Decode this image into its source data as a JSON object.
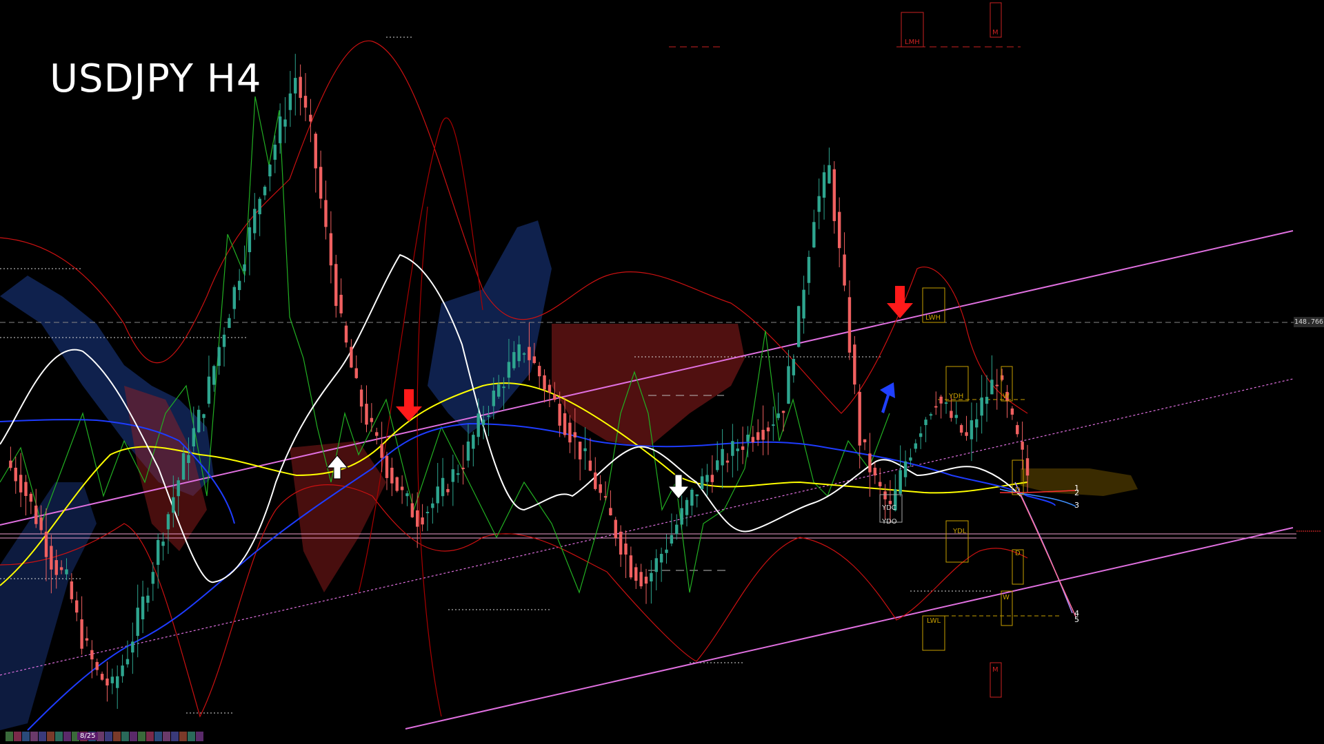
{
  "title": "USDJPY H4",
  "footer_date": "8/25",
  "price_label": "148.766",
  "colors": {
    "background": "#000000",
    "bull_candle": "#2ea58f",
    "bear_candle": "#f06060",
    "channel": "#e070e0",
    "bollinger": "#cc1111",
    "ma_white": "#ffffff",
    "ma_yellow": "#ffff00",
    "ma_blue": "#1e3cff",
    "rsi_green": "#22b022",
    "cloud_blue": "#1c3c8c",
    "cloud_red": "#a02020",
    "level_box": "#c8a000"
  },
  "arrows": [
    {
      "name": "sell-arrow-1",
      "type": "down",
      "color": "red"
    },
    {
      "name": "buy-arrow-1",
      "type": "up",
      "color": "white"
    },
    {
      "name": "sell-arrow-2",
      "type": "down",
      "color": "white"
    },
    {
      "name": "sell-arrow-3",
      "type": "down",
      "color": "red"
    },
    {
      "name": "buy-arrow-2",
      "type": "up",
      "color": "blue"
    }
  ],
  "level_labels": {
    "lmh": "LMH",
    "m_top": "M",
    "lwh": "LWH",
    "ydh": "YDH",
    "w_top": "W",
    "ydc": "YDC",
    "ydo": "YDO",
    "ydl": "YDL",
    "d_top": "D",
    "d_bottom": "D",
    "w_bottom": "W",
    "lwl": "LWL",
    "m_bottom": "M"
  },
  "right_numbers": [
    "1",
    "2",
    "3",
    "4",
    "5"
  ],
  "chart_data": {
    "type": "line",
    "title": "USDJPY H4",
    "symbol": "USDJPY",
    "timeframe": "H4",
    "current_price": 148.766,
    "price_series": [
      144.6,
      144.3,
      143.8,
      143.2,
      142.9,
      142.1,
      141.6,
      141.4,
      141.9,
      142.6,
      143.4,
      144.1,
      144.8,
      145.4,
      146.2,
      147.0,
      147.8,
      148.6,
      149.3,
      150.0,
      149.2,
      147.8,
      146.5,
      145.6,
      145.0,
      144.5,
      144.1,
      143.8,
      144.0,
      144.3,
      144.6,
      145.1,
      145.5,
      145.9,
      146.2,
      145.8,
      145.4,
      145.0,
      144.6,
      144.1,
      143.6,
      143.1,
      142.9,
      143.3,
      143.7,
      144.1,
      144.4,
      144.6,
      144.8,
      145.0,
      145.1,
      145.4,
      146.6,
      148.1,
      148.7,
      146.9,
      144.9,
      144.3,
      143.9,
      144.6,
      145.1,
      145.5,
      145.2,
      144.9,
      145.4,
      145.8,
      145.1,
      144.4
    ]
  }
}
